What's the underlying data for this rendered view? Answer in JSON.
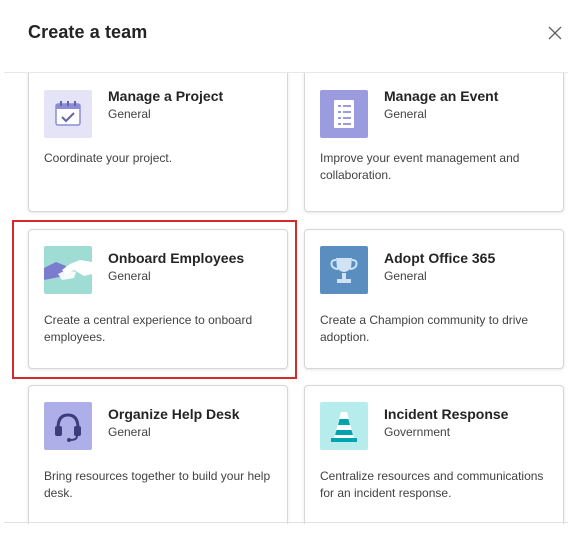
{
  "dialog": {
    "title": "Create a team",
    "close_icon": "close-icon"
  },
  "cards": [
    {
      "title": "Manage a Project",
      "subtitle": "General",
      "description": "Coordinate your project.",
      "icon": "calendar-check-icon",
      "icon_bg": "#e4e4f6"
    },
    {
      "title": "Manage an Event",
      "subtitle": "General",
      "description": "Improve your event management and collaboration.",
      "icon": "clipboard-list-icon",
      "icon_bg": "#9b9be0"
    },
    {
      "title": "Onboard Employees",
      "subtitle": "General",
      "description": "Create a central experience to onboard employees.",
      "icon": "handshake-icon",
      "icon_bg": "#9fdcd3"
    },
    {
      "title": "Adopt Office 365",
      "subtitle": "General",
      "description": "Create a Champion community to drive adoption.",
      "icon": "trophy-icon",
      "icon_bg": "#5a8ec0"
    },
    {
      "title": "Organize Help Desk",
      "subtitle": "General",
      "description": "Bring resources together to build your help desk.",
      "icon": "headset-icon",
      "icon_bg": "#aeaee8"
    },
    {
      "title": "Incident Response",
      "subtitle": "Government",
      "description": "Centralize resources and communications for an incident response.",
      "icon": "traffic-cone-icon",
      "icon_bg": "#b6ecec"
    }
  ],
  "highlight_color": "#d42a2a"
}
